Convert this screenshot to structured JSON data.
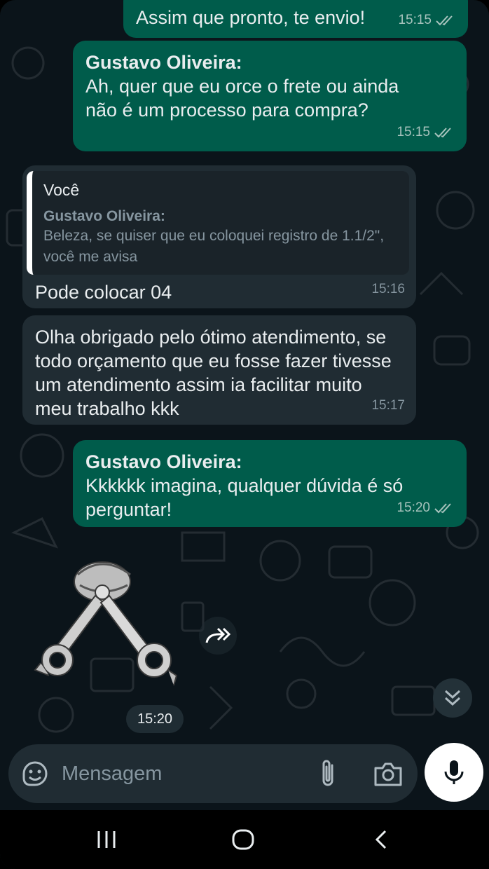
{
  "messages": [
    {
      "id": "m1",
      "direction": "out",
      "text": "Assim que pronto, te envio!",
      "time": "15:15"
    },
    {
      "id": "m2",
      "direction": "out",
      "sender": "Gustavo Oliveira:",
      "text": "Ah, quer que eu orce o frete ou ainda não é um processo para compra?",
      "time": "15:15"
    },
    {
      "id": "m3",
      "direction": "in",
      "quote": {
        "author": "Você",
        "sender": "Gustavo Oliveira:",
        "text": "Beleza, se quiser que eu coloquei registro de 1.1/2\", você me avisa"
      },
      "text": "Pode colocar 04",
      "time": "15:16"
    },
    {
      "id": "m4",
      "direction": "in",
      "text": "Olha obrigado pelo ótimo atendimento, se todo orçamento que eu fosse fazer tivesse um atendimento assim ia facilitar muito meu trabalho kkk",
      "time": "15:17"
    },
    {
      "id": "m5",
      "direction": "out",
      "sender": "Gustavo Oliveira:",
      "text": "Kkkkkk imagina, qualquer dúvida é só perguntar!",
      "time": "15:20"
    }
  ],
  "sticker": {
    "icon": "piston-sticker",
    "time": "15:20"
  },
  "composer": {
    "placeholder": "Mensagem"
  },
  "colors": {
    "background": "#0b141a",
    "outgoing_bubble": "#005c4b",
    "incoming_bubble": "#202c33",
    "text": "#e9edef",
    "muted": "#8696a0"
  },
  "icons": {
    "read_ticks": "double-check-icon",
    "forward": "forward-icon",
    "scroll_down": "double-chevron-down-icon",
    "emoji": "sticker-emoji-icon",
    "attach": "paperclip-icon",
    "camera": "camera-icon",
    "mic": "microphone-icon",
    "nav_recent": "recent-apps-icon",
    "nav_home": "home-icon",
    "nav_back": "back-icon"
  }
}
